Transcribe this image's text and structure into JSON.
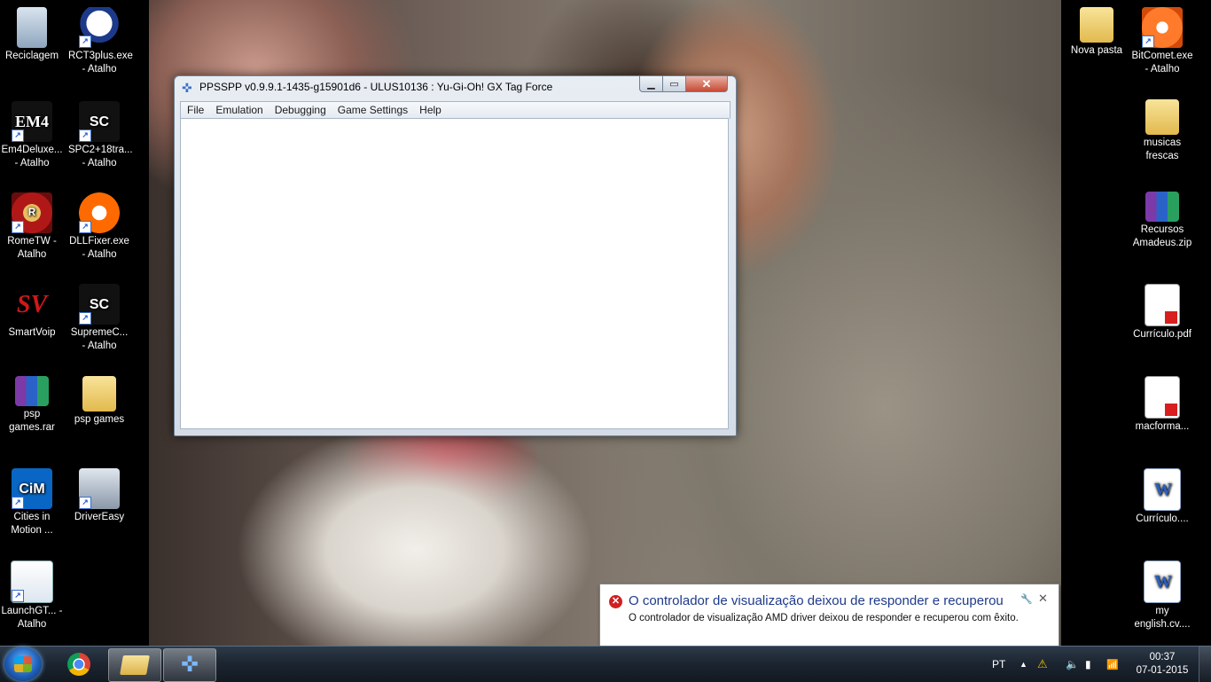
{
  "desktop": {
    "left_icons": [
      {
        "label": "Reciclagem",
        "icon": "recycle-bin-icon"
      },
      {
        "label": "RCT3plus.exe - Atalho",
        "icon": "panda-icon"
      },
      {
        "label": "Em4Deluxe... - Atalho",
        "icon": "em4-icon",
        "glyph": "EM4"
      },
      {
        "label": "SPC2+18tra... - Atalho",
        "icon": "sc2-icon",
        "glyph": "SC"
      },
      {
        "label": "RomeTW - Atalho",
        "icon": "rome-icon",
        "glyph": "R"
      },
      {
        "label": "DLLFixer.exe - Atalho",
        "icon": "dllfixer-icon"
      },
      {
        "label": "SmartVoip",
        "icon": "smartvoip-icon",
        "glyph": "SV"
      },
      {
        "label": "SupremeC... - Atalho",
        "icon": "sc2-icon",
        "glyph": "SC"
      },
      {
        "label": "psp games.rar",
        "icon": "winrar-icon"
      },
      {
        "label": "psp games",
        "icon": "folder-icon"
      },
      {
        "label": "Cities in Motion ...",
        "icon": "cities-in-motion-icon",
        "glyph": "CiM"
      },
      {
        "label": "DriverEasy",
        "icon": "drivereasy-icon"
      },
      {
        "label": "LaunchGT... - Atalho",
        "icon": "launcher-icon"
      }
    ],
    "right_icons": [
      {
        "label": "Nova pasta",
        "icon": "folder-icon"
      },
      {
        "label": "BitComet.exe - Atalho",
        "icon": "bitcomet-icon"
      },
      {
        "label": "musicas frescas",
        "icon": "folder-icon"
      },
      {
        "label": "Recursos Amadeus.zip",
        "icon": "winrar-icon"
      },
      {
        "label": "Currículo.pdf",
        "icon": "pdf-icon"
      },
      {
        "label": "macforma...",
        "icon": "pdf-icon"
      },
      {
        "label": "Currículo....",
        "icon": "word-doc-icon",
        "glyph": "W"
      },
      {
        "label": "my english.cv....",
        "icon": "word-doc-icon",
        "glyph": "W"
      }
    ]
  },
  "window": {
    "title": "PPSSPP v0.9.9.1-1435-g15901d6 - ULUS10136 : Yu-Gi-Oh!  GX Tag Force",
    "menu": [
      "File",
      "Emulation",
      "Debugging",
      "Game Settings",
      "Help"
    ]
  },
  "notification": {
    "title": "O controlador de visualização deixou de responder e recuperou",
    "message": "O controlador de visualização AMD driver deixou de responder e recuperou com êxito."
  },
  "taskbar": {
    "language": "PT",
    "time": "00:37",
    "date": "07-01-2015"
  }
}
